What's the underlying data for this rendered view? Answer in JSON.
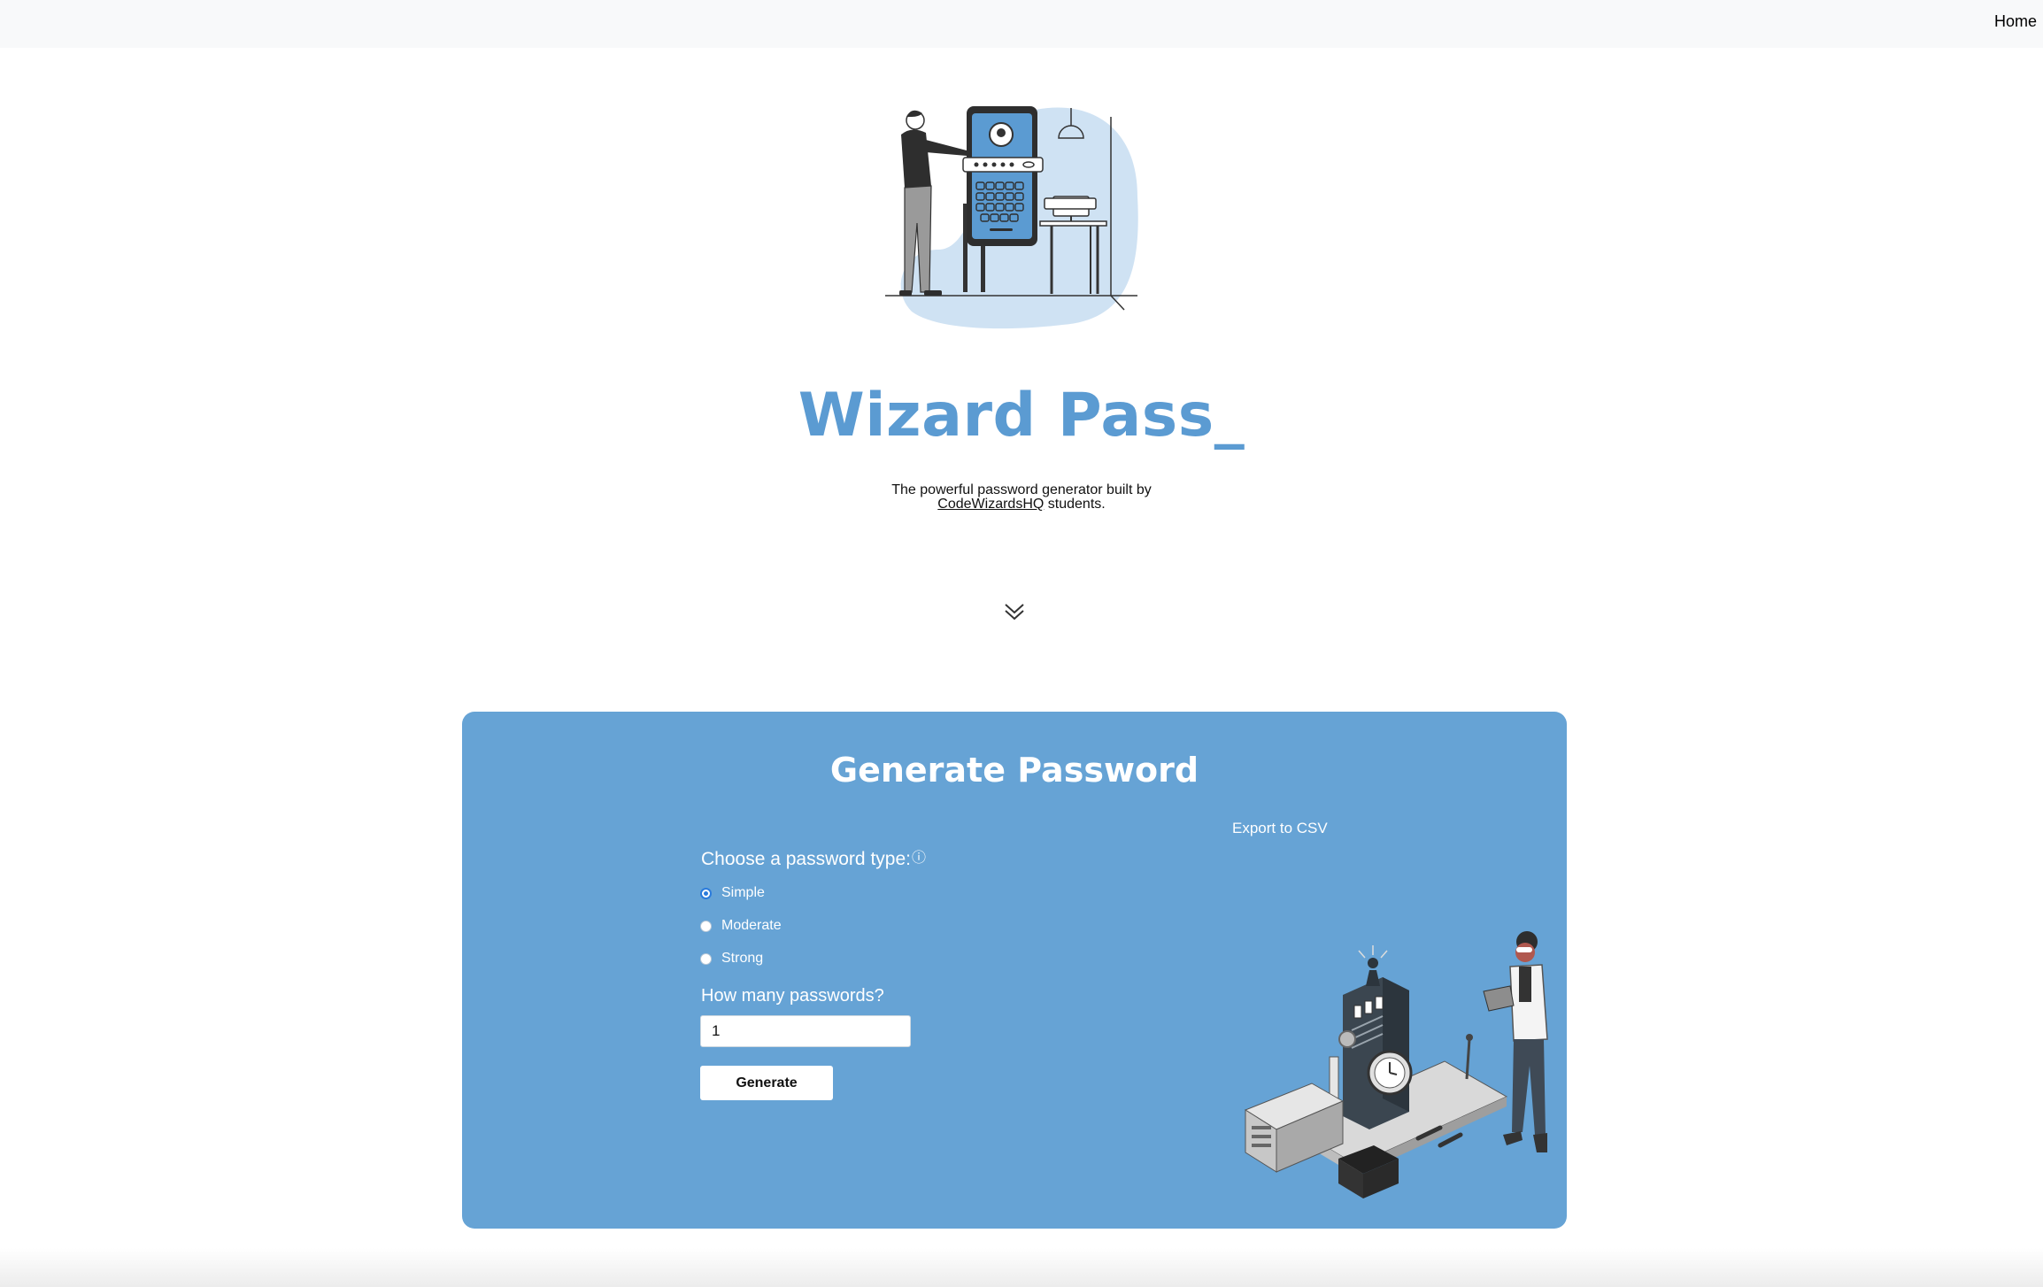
{
  "nav": {
    "home_label": "Home"
  },
  "hero": {
    "title": "Wizard Pass_",
    "tagline_prefix": "The powerful password generator built by",
    "tagline_link": "CodeWizardsHQ",
    "tagline_suffix": " students."
  },
  "generator": {
    "title": "Generate Password",
    "export_label": "Export to CSV",
    "type_label": "Choose a password type:",
    "info_glyph": "ⓘ",
    "options": [
      {
        "label": "Simple",
        "checked": true
      },
      {
        "label": "Moderate",
        "checked": false
      },
      {
        "label": "Strong",
        "checked": false
      }
    ],
    "count_label": "How many passwords?",
    "count_value": "1",
    "button_label": "Generate"
  },
  "colors": {
    "brand": "#5b9bd2",
    "panel": "#66a3d5",
    "radio_accent": "#2b7bdc"
  },
  "icons": [
    "password-login-illustration",
    "chevron-double-down-icon",
    "info-icon",
    "password-machine-illustration"
  ]
}
